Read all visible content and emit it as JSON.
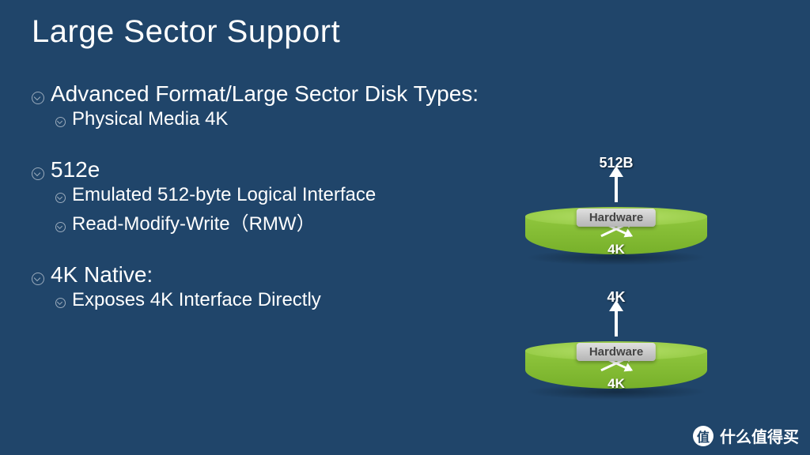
{
  "title": "Large Sector Support",
  "bullets": {
    "b1": "Advanced Format/Large Sector Disk Types:",
    "b1_1": "Physical Media 4K",
    "b2": "512e",
    "b2_1": "Emulated 512-byte Logical Interface",
    "b2_2": "Read-Modify-Write（RMW）",
    "b3": "4K Native:",
    "b3_1": "Exposes 4K Interface Directly"
  },
  "diagram1": {
    "top": "512B",
    "hw": "Hardware",
    "bottom": "4K"
  },
  "diagram2": {
    "top": "4K",
    "hw": "Hardware",
    "bottom": "4K"
  },
  "watermark": {
    "badge": "值",
    "text": "什么值得买"
  }
}
